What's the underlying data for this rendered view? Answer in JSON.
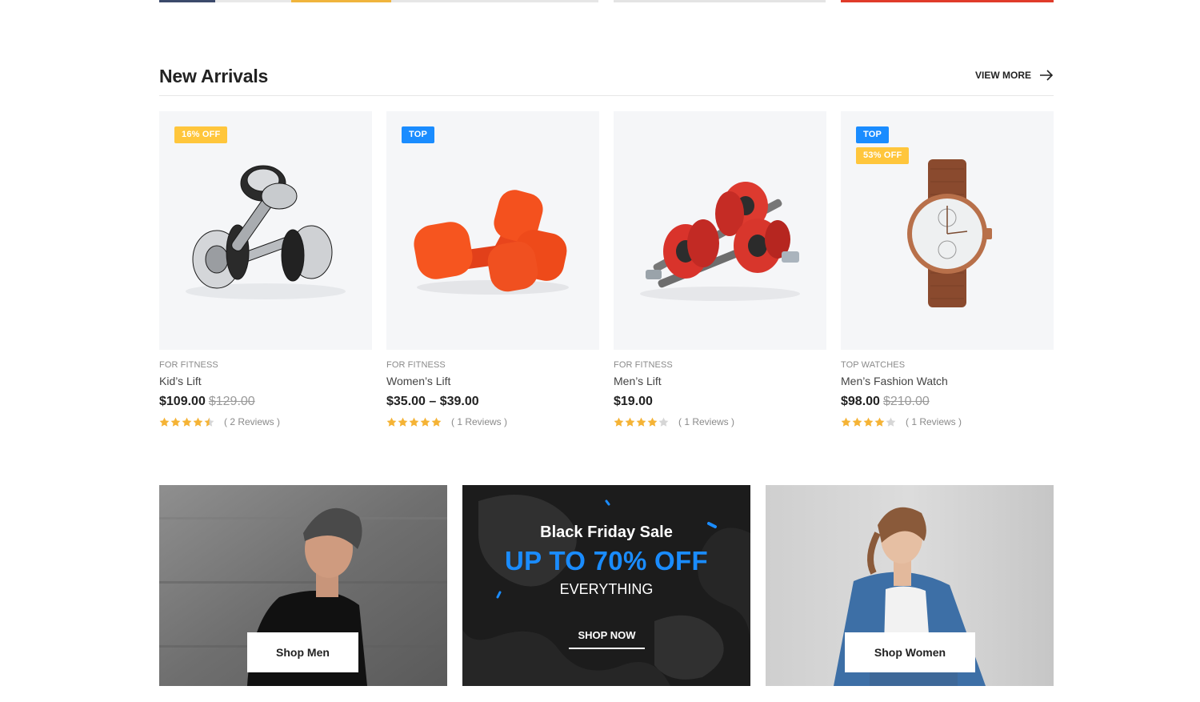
{
  "section": {
    "title": "New Arrivals",
    "view_more": "VIEW MORE"
  },
  "products": [
    {
      "badges": [
        "16% OFF"
      ],
      "category": "FOR FITNESS",
      "name": "Kid’s Lift",
      "price": "$109.00",
      "old_price": "$129.00",
      "rating": 4.5,
      "reviews": "( 2 Reviews )",
      "image": "chrome-dumbbells"
    },
    {
      "badges": [
        "TOP"
      ],
      "category": "FOR FITNESS",
      "name": "Women’s Lift",
      "price": "$35.00 – $39.00",
      "old_price": "",
      "rating": 5,
      "reviews": "( 1 Reviews )",
      "image": "orange-dumbbells"
    },
    {
      "badges": [],
      "category": "FOR FITNESS",
      "name": "Men’s Lift",
      "price": "$19.00",
      "old_price": "",
      "rating": 4,
      "reviews": "( 1 Reviews )",
      "image": "red-dumbbells"
    },
    {
      "badges": [
        "TOP",
        "53% OFF"
      ],
      "category": "TOP WATCHES",
      "name": "Men’s Fashion Watch",
      "price": "$98.00",
      "old_price": "$210.00",
      "rating": 4,
      "reviews": "( 1 Reviews )",
      "image": "brown-watch"
    }
  ],
  "banners": {
    "men": {
      "button": "Shop Men"
    },
    "promo": {
      "title": "Black Friday Sale",
      "headline": "UP TO 70% OFF",
      "subtitle": "EVERYTHING",
      "button": "SHOP NOW"
    },
    "women": {
      "button": "Shop Women"
    }
  },
  "colors": {
    "badge_sale": "#ffc63c",
    "badge_top": "#1a8cff",
    "star": "#f5b335",
    "promo_accent": "#1a8cff",
    "promo_bg": "#262626"
  }
}
